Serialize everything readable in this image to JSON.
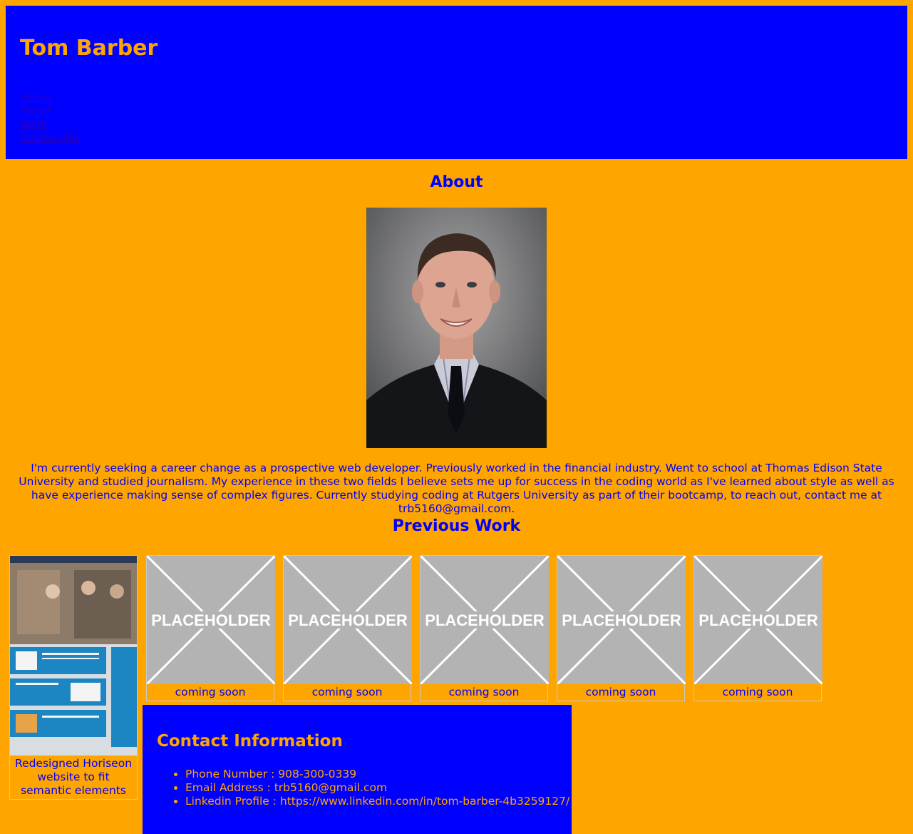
{
  "header": {
    "title": "Tom Barber",
    "nav": [
      "Home",
      "About",
      "Work",
      "Contact Me"
    ]
  },
  "about": {
    "heading": "About",
    "text": "I'm currently seeking a career change as a prospective web developer. Previously worked in the financial industry. Went to school at Thomas Edison State University and studied journalism. My experience in these two fields I believe sets me up for success in the coding world as I've learned about style as well as have experience making sense of complex figures. Currently studying coding at Rutgers University as part of their bootcamp, to reach out, contact me at trb5160@gmail.com."
  },
  "work": {
    "heading": "Previous Work",
    "featured_caption": "Redesigned Horiseon website to fit semantic elements",
    "placeholder_label": "PLACEHOLDER",
    "items": [
      {
        "caption": "coming soon"
      },
      {
        "caption": "coming soon"
      },
      {
        "caption": "coming soon"
      },
      {
        "caption": "coming soon"
      },
      {
        "caption": "coming soon"
      }
    ]
  },
  "contact": {
    "heading": "Contact Information",
    "items": [
      "Phone Number : 908-300-0339",
      "Email Address : trb5160@gmail.com",
      "Linkedin Profile : https://www.linkedin.com/in/tom-barber-4b3259127/"
    ]
  },
  "colors": {
    "background": "#ffa500",
    "accent": "#0000ff"
  }
}
